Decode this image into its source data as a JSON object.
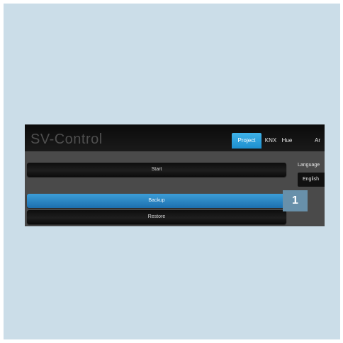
{
  "app": {
    "title": "SV-Control"
  },
  "tabs": [
    {
      "label": "Project",
      "active": true
    },
    {
      "label": "KNX",
      "active": false
    },
    {
      "label": "Hue",
      "active": false
    },
    {
      "label": "Ar",
      "active": false
    }
  ],
  "buttons": {
    "start": "Start",
    "backup": "Backup",
    "restore": "Restore"
  },
  "language": {
    "label": "Language",
    "selected": "English"
  },
  "callout": {
    "number": "1"
  },
  "colors": {
    "background": "#cbdde8",
    "accent": "#2a9ad8",
    "callout": "#6890aa"
  }
}
